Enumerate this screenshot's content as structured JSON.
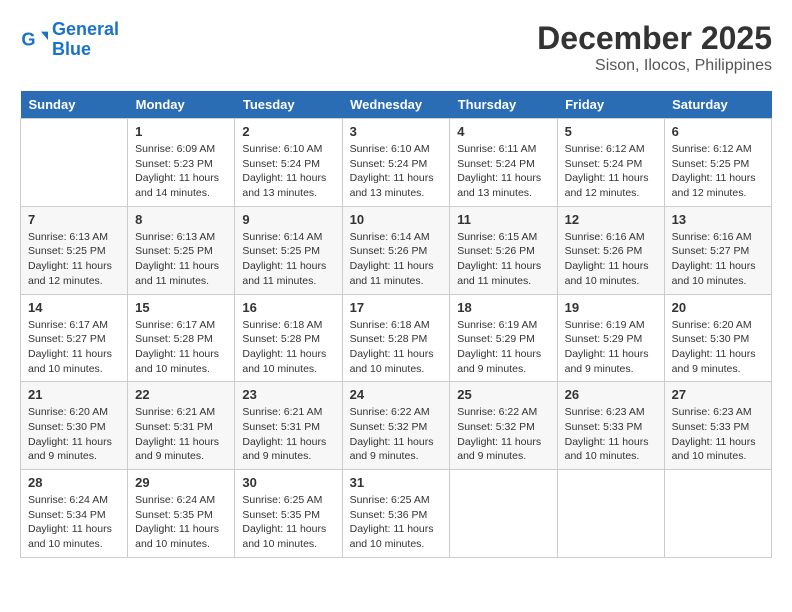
{
  "logo": {
    "line1": "General",
    "line2": "Blue"
  },
  "title": "December 2025",
  "subtitle": "Sison, Ilocos, Philippines",
  "days": [
    "Sunday",
    "Monday",
    "Tuesday",
    "Wednesday",
    "Thursday",
    "Friday",
    "Saturday"
  ],
  "weeks": [
    [
      {
        "date": "",
        "sunrise": "",
        "sunset": "",
        "daylight": ""
      },
      {
        "date": "1",
        "sunrise": "6:09 AM",
        "sunset": "5:23 PM",
        "daylight": "11 hours and 14 minutes."
      },
      {
        "date": "2",
        "sunrise": "6:10 AM",
        "sunset": "5:24 PM",
        "daylight": "11 hours and 13 minutes."
      },
      {
        "date": "3",
        "sunrise": "6:10 AM",
        "sunset": "5:24 PM",
        "daylight": "11 hours and 13 minutes."
      },
      {
        "date": "4",
        "sunrise": "6:11 AM",
        "sunset": "5:24 PM",
        "daylight": "11 hours and 13 minutes."
      },
      {
        "date": "5",
        "sunrise": "6:12 AM",
        "sunset": "5:24 PM",
        "daylight": "11 hours and 12 minutes."
      },
      {
        "date": "6",
        "sunrise": "6:12 AM",
        "sunset": "5:25 PM",
        "daylight": "11 hours and 12 minutes."
      }
    ],
    [
      {
        "date": "7",
        "sunrise": "6:13 AM",
        "sunset": "5:25 PM",
        "daylight": "11 hours and 12 minutes."
      },
      {
        "date": "8",
        "sunrise": "6:13 AM",
        "sunset": "5:25 PM",
        "daylight": "11 hours and 11 minutes."
      },
      {
        "date": "9",
        "sunrise": "6:14 AM",
        "sunset": "5:25 PM",
        "daylight": "11 hours and 11 minutes."
      },
      {
        "date": "10",
        "sunrise": "6:14 AM",
        "sunset": "5:26 PM",
        "daylight": "11 hours and 11 minutes."
      },
      {
        "date": "11",
        "sunrise": "6:15 AM",
        "sunset": "5:26 PM",
        "daylight": "11 hours and 11 minutes."
      },
      {
        "date": "12",
        "sunrise": "6:16 AM",
        "sunset": "5:26 PM",
        "daylight": "11 hours and 10 minutes."
      },
      {
        "date": "13",
        "sunrise": "6:16 AM",
        "sunset": "5:27 PM",
        "daylight": "11 hours and 10 minutes."
      }
    ],
    [
      {
        "date": "14",
        "sunrise": "6:17 AM",
        "sunset": "5:27 PM",
        "daylight": "11 hours and 10 minutes."
      },
      {
        "date": "15",
        "sunrise": "6:17 AM",
        "sunset": "5:28 PM",
        "daylight": "11 hours and 10 minutes."
      },
      {
        "date": "16",
        "sunrise": "6:18 AM",
        "sunset": "5:28 PM",
        "daylight": "11 hours and 10 minutes."
      },
      {
        "date": "17",
        "sunrise": "6:18 AM",
        "sunset": "5:28 PM",
        "daylight": "11 hours and 10 minutes."
      },
      {
        "date": "18",
        "sunrise": "6:19 AM",
        "sunset": "5:29 PM",
        "daylight": "11 hours and 9 minutes."
      },
      {
        "date": "19",
        "sunrise": "6:19 AM",
        "sunset": "5:29 PM",
        "daylight": "11 hours and 9 minutes."
      },
      {
        "date": "20",
        "sunrise": "6:20 AM",
        "sunset": "5:30 PM",
        "daylight": "11 hours and 9 minutes."
      }
    ],
    [
      {
        "date": "21",
        "sunrise": "6:20 AM",
        "sunset": "5:30 PM",
        "daylight": "11 hours and 9 minutes."
      },
      {
        "date": "22",
        "sunrise": "6:21 AM",
        "sunset": "5:31 PM",
        "daylight": "11 hours and 9 minutes."
      },
      {
        "date": "23",
        "sunrise": "6:21 AM",
        "sunset": "5:31 PM",
        "daylight": "11 hours and 9 minutes."
      },
      {
        "date": "24",
        "sunrise": "6:22 AM",
        "sunset": "5:32 PM",
        "daylight": "11 hours and 9 minutes."
      },
      {
        "date": "25",
        "sunrise": "6:22 AM",
        "sunset": "5:32 PM",
        "daylight": "11 hours and 9 minutes."
      },
      {
        "date": "26",
        "sunrise": "6:23 AM",
        "sunset": "5:33 PM",
        "daylight": "11 hours and 10 minutes."
      },
      {
        "date": "27",
        "sunrise": "6:23 AM",
        "sunset": "5:33 PM",
        "daylight": "11 hours and 10 minutes."
      }
    ],
    [
      {
        "date": "28",
        "sunrise": "6:24 AM",
        "sunset": "5:34 PM",
        "daylight": "11 hours and 10 minutes."
      },
      {
        "date": "29",
        "sunrise": "6:24 AM",
        "sunset": "5:35 PM",
        "daylight": "11 hours and 10 minutes."
      },
      {
        "date": "30",
        "sunrise": "6:25 AM",
        "sunset": "5:35 PM",
        "daylight": "11 hours and 10 minutes."
      },
      {
        "date": "31",
        "sunrise": "6:25 AM",
        "sunset": "5:36 PM",
        "daylight": "11 hours and 10 minutes."
      },
      {
        "date": "",
        "sunrise": "",
        "sunset": "",
        "daylight": ""
      },
      {
        "date": "",
        "sunrise": "",
        "sunset": "",
        "daylight": ""
      },
      {
        "date": "",
        "sunrise": "",
        "sunset": "",
        "daylight": ""
      }
    ]
  ],
  "labels": {
    "sunrise": "Sunrise:",
    "sunset": "Sunset:",
    "daylight": "Daylight:"
  }
}
